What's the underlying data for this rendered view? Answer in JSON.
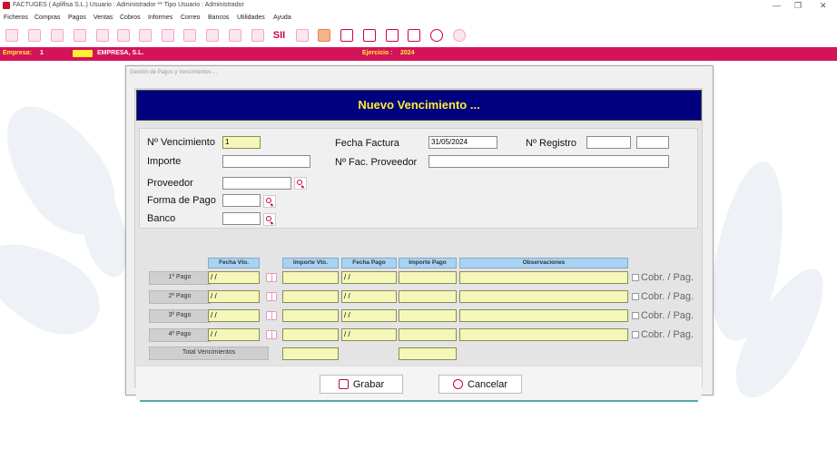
{
  "titlebar": {
    "title": "FACTUGES  ( Aplifisa S.L.)   Usuario : Administrador   **  Tipo Usuario : Administrador",
    "minimize": "—",
    "restore": "❐",
    "close": "✕"
  },
  "menu": [
    "Ficheros",
    "Compras",
    "Pagos",
    "Ventas",
    "Cobros",
    "Informes",
    "Correo",
    "Bancos",
    "Utilidades",
    "Ayuda"
  ],
  "toolbar_icons": [
    "clients-icon",
    "suppliers-icon",
    "users-icon",
    "person-icon",
    "group-icon",
    "contacts-icon",
    "documents-icon",
    "invoice-icon",
    "edit-icon",
    "list-icon",
    "report-icon",
    "euro-icon",
    "euro-bag-icon",
    "sii-icon",
    "pdf-icon",
    "a-icon",
    "calendar-icon",
    "monitor-icon",
    "calculator-icon",
    "folders-icon",
    "help-icon",
    "power-icon"
  ],
  "toolbar_sii_label": "SII",
  "status": {
    "empresa_label": "Empresa:",
    "empresa_num": "1",
    "empresa_name": "EMPRESA, S.L.",
    "ejercicio_label": "Ejercicio :",
    "ejercicio_value": "2024"
  },
  "dialog": {
    "title": "Gestión de Pagos y Vencimientos ...",
    "banner": "Nuevo Vencimiento ...",
    "fields": {
      "num_vencimiento_label": "Nº Vencimiento",
      "num_vencimiento_value": "1",
      "importe_label": "Importe",
      "importe_value": "",
      "proveedor_label": "Proveedor",
      "proveedor_value": "",
      "forma_pago_label": "Forma de Pago",
      "forma_pago_value": "",
      "banco_label": "Banco",
      "banco_value": "",
      "fecha_factura_label": "Fecha Factura",
      "fecha_factura_value": "31/05/2024",
      "num_registro_label": "Nº Registro",
      "num_registro_value_1": "",
      "num_registro_value_2": "",
      "num_fac_proveedor_label": "Nº Fac. Proveedor",
      "num_fac_proveedor_value": ""
    },
    "grid": {
      "headers": [
        "Fecha Vto.",
        "Importe Vto.",
        "Fecha Pago",
        "Importe Pago",
        "Observaciones"
      ],
      "rows": [
        {
          "label": "1º Pago",
          "fecha_vto": "/ /",
          "importe_vto": "",
          "fecha_pago": "/ /",
          "importe_pago": "",
          "observaciones": "",
          "check_label": "Cobr. / Pag."
        },
        {
          "label": "2º Pago",
          "fecha_vto": "/ /",
          "importe_vto": "",
          "fecha_pago": "/ /",
          "importe_pago": "",
          "observaciones": "",
          "check_label": "Cobr. / Pag."
        },
        {
          "label": "3º Pago",
          "fecha_vto": "/ /",
          "importe_vto": "",
          "fecha_pago": "/ /",
          "importe_pago": "",
          "observaciones": "",
          "check_label": "Cobr. / Pag."
        },
        {
          "label": "4º Pago",
          "fecha_vto": "/ /",
          "importe_vto": "",
          "fecha_pago": "/ /",
          "importe_pago": "",
          "observaciones": "",
          "check_label": "Cobr. / Pag."
        }
      ],
      "total_label": "Total Vencimientos",
      "total_importe_vto": "",
      "total_importe_pago": ""
    },
    "buttons": {
      "grabar": "Grabar",
      "cancelar": "Cancelar"
    }
  },
  "colors": {
    "status_bar": "#d4145a",
    "banner_bg": "#000080",
    "banner_text": "#ffee33",
    "header_cell": "#a9d3f3",
    "input_yellow": "#f5f7b8"
  }
}
